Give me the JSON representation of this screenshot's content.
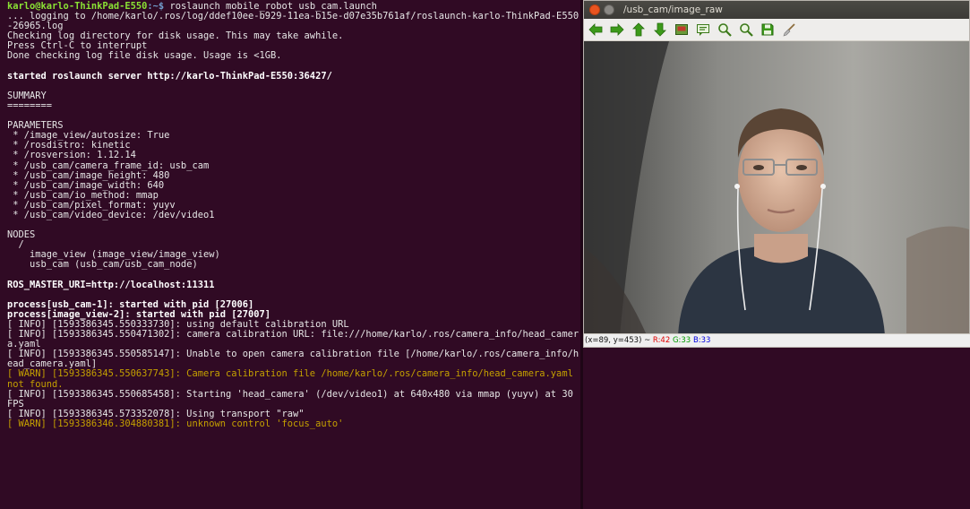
{
  "terminal": {
    "prompt_user": "karlo@karlo-ThinkPad-E550",
    "prompt_path": ":~$",
    "command": " roslaunch mobile_robot usb_cam.launch",
    "lines": [
      "... logging to /home/karlo/.ros/log/ddef10ee-b929-11ea-b15e-d07e35b761af/roslaunch-karlo-ThinkPad-E550-26965.log",
      "Checking log directory for disk usage. This may take awhile.",
      "Press Ctrl-C to interrupt",
      "Done checking log file disk usage. Usage is <1GB.",
      "",
      "started roslaunch server http://karlo-ThinkPad-E550:36427/",
      "",
      "SUMMARY",
      "========",
      "",
      "PARAMETERS",
      " * /image_view/autosize: True",
      " * /rosdistro: kinetic",
      " * /rosversion: 1.12.14",
      " * /usb_cam/camera_frame_id: usb_cam",
      " * /usb_cam/image_height: 480",
      " * /usb_cam/image_width: 640",
      " * /usb_cam/io_method: mmap",
      " * /usb_cam/pixel_format: yuyv",
      " * /usb_cam/video_device: /dev/video1",
      "",
      "NODES",
      "  /",
      "    image_view (image_view/image_view)",
      "    usb_cam (usb_cam/usb_cam_node)",
      "",
      "ROS_MASTER_URI=http://localhost:11311",
      "",
      "process[usb_cam-1]: started with pid [27006]",
      "process[image_view-2]: started with pid [27007]",
      "[ INFO] [1593386345.550333730]: using default calibration URL",
      "[ INFO] [1593386345.550471302]: camera calibration URL: file:///home/karlo/.ros/camera_info/head_camera.yaml",
      "[ INFO] [1593386345.550585147]: Unable to open camera calibration file [/home/karlo/.ros/camera_info/head_camera.yaml]",
      "[ WARN] [1593386345.550637743]: Camera calibration file /home/karlo/.ros/camera_info/head_camera.yaml not found.",
      "[ INFO] [1593386345.550685458]: Starting 'head_camera' (/dev/video1) at 640x480 via mmap (yuyv) at 30 FPS",
      "[ INFO] [1593386345.573352078]: Using transport \"raw\"",
      "[ WARN] [1593386346.304880381]: unknown control 'focus_auto'"
    ]
  },
  "viewer": {
    "title": "/usb_cam/image_raw",
    "toolbar": [
      "back-arrow-icon",
      "forward-arrow-icon",
      "up-arrow-icon",
      "down-arrow-icon",
      "fit-image-icon",
      "fit-text-icon",
      "zoom-in-icon",
      "zoom-out-icon",
      "save-icon",
      "clean-brush-icon"
    ],
    "status": {
      "coords": "(x=89, y=453) ~ ",
      "r": "R:42",
      "g": "G:33",
      "b": "B:33"
    }
  }
}
